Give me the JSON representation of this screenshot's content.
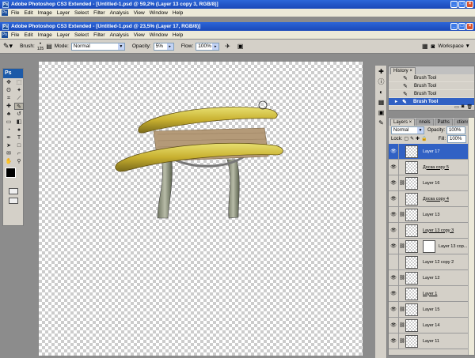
{
  "app_window": {
    "title": "Adobe Photoshop CS3 Extended - [Untitled-1.psd @ 59,2% (Layer 13 copy 3, RGB/8)]",
    "menu": [
      "File",
      "Edit",
      "Image",
      "Layer",
      "Select",
      "Filter",
      "Analysis",
      "View",
      "Window",
      "Help"
    ]
  },
  "doc_window": {
    "title": "Adobe Photoshop CS3 Extended - [Untitled-1.psd @ 23,5% (Layer 17, RGB/8)]",
    "menu": [
      "File",
      "Edit",
      "Image",
      "Layer",
      "Select",
      "Filter",
      "Analysis",
      "View",
      "Window",
      "Help"
    ]
  },
  "options": {
    "brush_label": "Brush:",
    "brush_size": "125",
    "mode_label": "Mode:",
    "mode_value": "Normal",
    "opacity_label": "Opacity:",
    "opacity_value": "5%",
    "flow_label": "Flow:",
    "flow_value": "100%",
    "workspace_label": "Workspace"
  },
  "toolbox": {
    "logo": "Ps"
  },
  "history": {
    "tab": "History",
    "items": [
      "Brush Tool",
      "Brush Tool",
      "Brush Tool",
      "Brush Tool"
    ]
  },
  "layers": {
    "tabs": [
      "Layers",
      "nnels",
      "Paths",
      "ctions"
    ],
    "blend_mode": "Normal",
    "opacity_label": "Opacity:",
    "opacity_value": "100%",
    "lock_label": "Lock:",
    "fill_label": "Fill:",
    "fill_value": "100%",
    "items": [
      {
        "name": "Layer 17",
        "active": true
      },
      {
        "name": "Доска copy 5",
        "active": false
      },
      {
        "name": "Layer 16",
        "active": false
      },
      {
        "name": "Доска copy 4",
        "active": false
      },
      {
        "name": "Layer 13",
        "active": false
      },
      {
        "name": "Layer 13 copy 3",
        "active": false
      },
      {
        "name": "Layer 13 cop...",
        "active": false
      },
      {
        "name": "Layer 12 copy 2",
        "active": false
      },
      {
        "name": "Layer 12",
        "active": false
      },
      {
        "name": "Layer 1",
        "active": false
      },
      {
        "name": "Layer 15",
        "active": false
      },
      {
        "name": "Layer 14",
        "active": false
      },
      {
        "name": "Layer 11",
        "active": false
      }
    ]
  }
}
